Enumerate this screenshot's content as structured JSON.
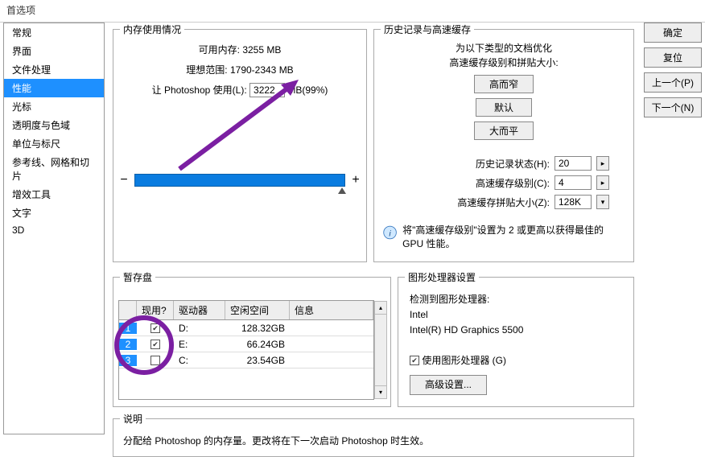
{
  "window_title": "首选项",
  "sidebar": {
    "items": [
      {
        "label": "常规"
      },
      {
        "label": "界面"
      },
      {
        "label": "文件处理"
      },
      {
        "label": "性能",
        "selected": true
      },
      {
        "label": "光标"
      },
      {
        "label": "透明度与色域"
      },
      {
        "label": "单位与标尺"
      },
      {
        "label": "参考线、网格和切片"
      },
      {
        "label": "增效工具"
      },
      {
        "label": "文字"
      },
      {
        "label": "3D"
      }
    ]
  },
  "memory": {
    "legend": "内存使用情况",
    "avail_label": "可用内存:",
    "avail_value": "3255 MB",
    "ideal_label": "理想范围:",
    "ideal_value": "1790-2343 MB",
    "let_ps_label": "让 Photoshop 使用(L):",
    "let_ps_value": "3222",
    "let_ps_suffix": "MB(99%)",
    "minus": "−",
    "plus": "+"
  },
  "history": {
    "legend": "历史记录与高速缓存",
    "opt_line1": "为以下类型的文档优化",
    "opt_line2": "高速缓存级别和拼贴大小:",
    "btn_tall": "高而窄",
    "btn_default": "默认",
    "btn_wide": "大而平",
    "states_label": "历史记录状态(H):",
    "states_value": "20",
    "levels_label": "高速缓存级别(C):",
    "levels_value": "4",
    "tile_label": "高速缓存拼贴大小(Z):",
    "tile_value": "128K",
    "info_text": "将\"高速缓存级别\"设置为 2 或更高以获得最佳的 GPU 性能。"
  },
  "scratch": {
    "legend": "暂存盘",
    "headers": {
      "num": "",
      "active": "现用?",
      "drive": "驱动器",
      "free": "空闲空间",
      "info": "信息"
    },
    "rows": [
      {
        "num": "1",
        "active": true,
        "drive": "D:",
        "free": "128.32GB"
      },
      {
        "num": "2",
        "active": true,
        "drive": "E:",
        "free": "66.24GB"
      },
      {
        "num": "3",
        "active": false,
        "drive": "C:",
        "free": "23.54GB"
      }
    ]
  },
  "gpu": {
    "legend": "图形处理器设置",
    "detected_label": "检测到图形处理器:",
    "vendor": "Intel",
    "model": "Intel(R) HD Graphics 5500",
    "use_gpu_label": "使用图形处理器 (G)",
    "use_gpu_checked": true,
    "adv_btn": "高级设置..."
  },
  "desc": {
    "legend": "说明",
    "text": "分配给 Photoshop 的内存量。更改将在下一次启动 Photoshop 时生效。"
  },
  "buttons": {
    "ok": "确定",
    "reset": "复位",
    "prev": "上一个(P)",
    "next": "下一个(N)"
  }
}
